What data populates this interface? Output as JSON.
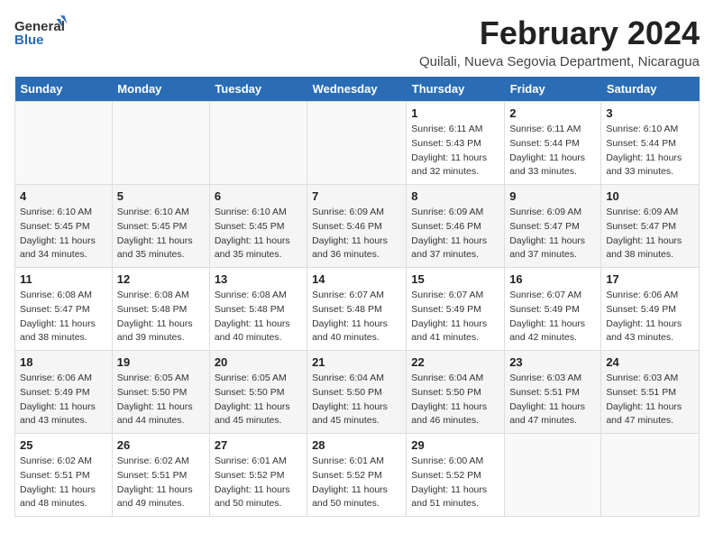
{
  "header": {
    "logo_general": "General",
    "logo_blue": "Blue",
    "title": "February 2024",
    "location": "Quilali, Nueva Segovia Department, Nicaragua"
  },
  "weekdays": [
    "Sunday",
    "Monday",
    "Tuesday",
    "Wednesday",
    "Thursday",
    "Friday",
    "Saturday"
  ],
  "weeks": [
    [
      {
        "day": "",
        "info": ""
      },
      {
        "day": "",
        "info": ""
      },
      {
        "day": "",
        "info": ""
      },
      {
        "day": "",
        "info": ""
      },
      {
        "day": "1",
        "info": "Sunrise: 6:11 AM\nSunset: 5:43 PM\nDaylight: 11 hours\nand 32 minutes."
      },
      {
        "day": "2",
        "info": "Sunrise: 6:11 AM\nSunset: 5:44 PM\nDaylight: 11 hours\nand 33 minutes."
      },
      {
        "day": "3",
        "info": "Sunrise: 6:10 AM\nSunset: 5:44 PM\nDaylight: 11 hours\nand 33 minutes."
      }
    ],
    [
      {
        "day": "4",
        "info": "Sunrise: 6:10 AM\nSunset: 5:45 PM\nDaylight: 11 hours\nand 34 minutes."
      },
      {
        "day": "5",
        "info": "Sunrise: 6:10 AM\nSunset: 5:45 PM\nDaylight: 11 hours\nand 35 minutes."
      },
      {
        "day": "6",
        "info": "Sunrise: 6:10 AM\nSunset: 5:45 PM\nDaylight: 11 hours\nand 35 minutes."
      },
      {
        "day": "7",
        "info": "Sunrise: 6:09 AM\nSunset: 5:46 PM\nDaylight: 11 hours\nand 36 minutes."
      },
      {
        "day": "8",
        "info": "Sunrise: 6:09 AM\nSunset: 5:46 PM\nDaylight: 11 hours\nand 37 minutes."
      },
      {
        "day": "9",
        "info": "Sunrise: 6:09 AM\nSunset: 5:47 PM\nDaylight: 11 hours\nand 37 minutes."
      },
      {
        "day": "10",
        "info": "Sunrise: 6:09 AM\nSunset: 5:47 PM\nDaylight: 11 hours\nand 38 minutes."
      }
    ],
    [
      {
        "day": "11",
        "info": "Sunrise: 6:08 AM\nSunset: 5:47 PM\nDaylight: 11 hours\nand 38 minutes."
      },
      {
        "day": "12",
        "info": "Sunrise: 6:08 AM\nSunset: 5:48 PM\nDaylight: 11 hours\nand 39 minutes."
      },
      {
        "day": "13",
        "info": "Sunrise: 6:08 AM\nSunset: 5:48 PM\nDaylight: 11 hours\nand 40 minutes."
      },
      {
        "day": "14",
        "info": "Sunrise: 6:07 AM\nSunset: 5:48 PM\nDaylight: 11 hours\nand 40 minutes."
      },
      {
        "day": "15",
        "info": "Sunrise: 6:07 AM\nSunset: 5:49 PM\nDaylight: 11 hours\nand 41 minutes."
      },
      {
        "day": "16",
        "info": "Sunrise: 6:07 AM\nSunset: 5:49 PM\nDaylight: 11 hours\nand 42 minutes."
      },
      {
        "day": "17",
        "info": "Sunrise: 6:06 AM\nSunset: 5:49 PM\nDaylight: 11 hours\nand 43 minutes."
      }
    ],
    [
      {
        "day": "18",
        "info": "Sunrise: 6:06 AM\nSunset: 5:49 PM\nDaylight: 11 hours\nand 43 minutes."
      },
      {
        "day": "19",
        "info": "Sunrise: 6:05 AM\nSunset: 5:50 PM\nDaylight: 11 hours\nand 44 minutes."
      },
      {
        "day": "20",
        "info": "Sunrise: 6:05 AM\nSunset: 5:50 PM\nDaylight: 11 hours\nand 45 minutes."
      },
      {
        "day": "21",
        "info": "Sunrise: 6:04 AM\nSunset: 5:50 PM\nDaylight: 11 hours\nand 45 minutes."
      },
      {
        "day": "22",
        "info": "Sunrise: 6:04 AM\nSunset: 5:50 PM\nDaylight: 11 hours\nand 46 minutes."
      },
      {
        "day": "23",
        "info": "Sunrise: 6:03 AM\nSunset: 5:51 PM\nDaylight: 11 hours\nand 47 minutes."
      },
      {
        "day": "24",
        "info": "Sunrise: 6:03 AM\nSunset: 5:51 PM\nDaylight: 11 hours\nand 47 minutes."
      }
    ],
    [
      {
        "day": "25",
        "info": "Sunrise: 6:02 AM\nSunset: 5:51 PM\nDaylight: 11 hours\nand 48 minutes."
      },
      {
        "day": "26",
        "info": "Sunrise: 6:02 AM\nSunset: 5:51 PM\nDaylight: 11 hours\nand 49 minutes."
      },
      {
        "day": "27",
        "info": "Sunrise: 6:01 AM\nSunset: 5:52 PM\nDaylight: 11 hours\nand 50 minutes."
      },
      {
        "day": "28",
        "info": "Sunrise: 6:01 AM\nSunset: 5:52 PM\nDaylight: 11 hours\nand 50 minutes."
      },
      {
        "day": "29",
        "info": "Sunrise: 6:00 AM\nSunset: 5:52 PM\nDaylight: 11 hours\nand 51 minutes."
      },
      {
        "day": "",
        "info": ""
      },
      {
        "day": "",
        "info": ""
      }
    ]
  ]
}
